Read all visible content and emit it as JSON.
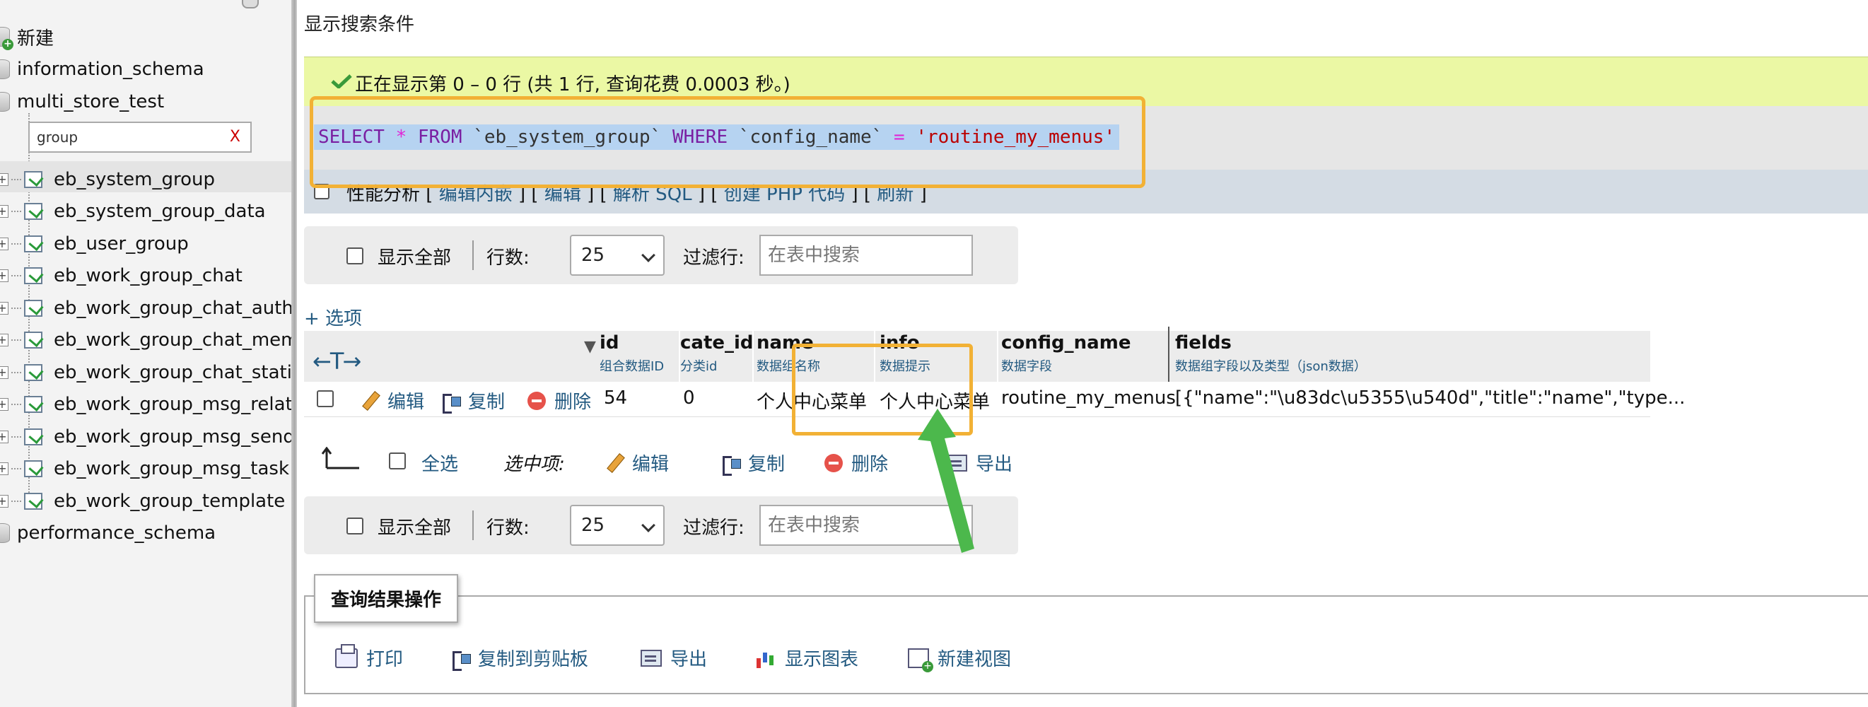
{
  "sidebar": {
    "new_label": "新建",
    "databases": [
      "information_schema",
      "multi_store_test",
      "performance_schema"
    ],
    "filter_value": "group",
    "filter_clear": "X",
    "tables": [
      "eb_system_group",
      "eb_system_group_data",
      "eb_user_group",
      "eb_work_group_chat",
      "eb_work_group_chat_auth",
      "eb_work_group_chat_membe",
      "eb_work_group_chat_statist",
      "eb_work_group_msg_relation",
      "eb_work_group_msg_send_r",
      "eb_work_group_msg_task",
      "eb_work_group_template"
    ]
  },
  "main": {
    "title": "显示搜索条件",
    "success_message": "正在显示第 0 – 0 行 (共 1 行, 查询花费 0.0003 秒。)",
    "sql": {
      "select": "SELECT",
      "star": "*",
      "from": "FROM",
      "table": "`eb_system_group`",
      "where": "WHERE",
      "column": "`config_name`",
      "eq": "=",
      "value": "'routine_my_menus'"
    },
    "profile": {
      "label": "性能分析",
      "links": [
        "编辑内嵌",
        "编辑",
        "解析 SQL",
        "创建 PHP 代码",
        "刷新"
      ]
    },
    "nav": {
      "show_all": "显示全部",
      "rows_label": "行数:",
      "rows_value": "25",
      "filter_label": "过滤行:",
      "filter_placeholder": "在表中搜索"
    },
    "options_link": "+ 选项",
    "table": {
      "arrows": "←T→",
      "columns": [
        {
          "name": "id",
          "sub": "组合数据ID"
        },
        {
          "name": "cate_id",
          "sub": "分类id"
        },
        {
          "name": "name",
          "sub": "数据组名称"
        },
        {
          "name": "info",
          "sub": "数据提示"
        },
        {
          "name": "config_name",
          "sub": "数据字段"
        },
        {
          "name": "fields",
          "sub": "数据组字段以及类型（json数据）"
        }
      ],
      "row_actions": {
        "edit": "编辑",
        "copy": "复制",
        "delete": "删除"
      },
      "rows": [
        {
          "id": "54",
          "cate_id": "0",
          "name": "个人中心菜单",
          "info": "个人中心菜单",
          "config_name": "routine_my_menus",
          "fields": "[{\"name\":\"\\u83dc\\u5355\\u540d\",\"title\":\"name\",\"type..."
        }
      ]
    },
    "bulk": {
      "select_all": "全选",
      "selected_label": "选中项:",
      "edit": "编辑",
      "copy": "复制",
      "delete": "删除",
      "export": "导出"
    },
    "operations": {
      "legend": "查询结果操作",
      "print": "打印",
      "copy_clipboard": "复制到剪贴板",
      "export": "导出",
      "chart": "显示图表",
      "create_view": "新建视图"
    }
  },
  "colors": {
    "success_bg": "#ebf8a4",
    "highlight_border": "#f2b135",
    "arrow_green": "#4cb84c",
    "link": "#235a81"
  }
}
